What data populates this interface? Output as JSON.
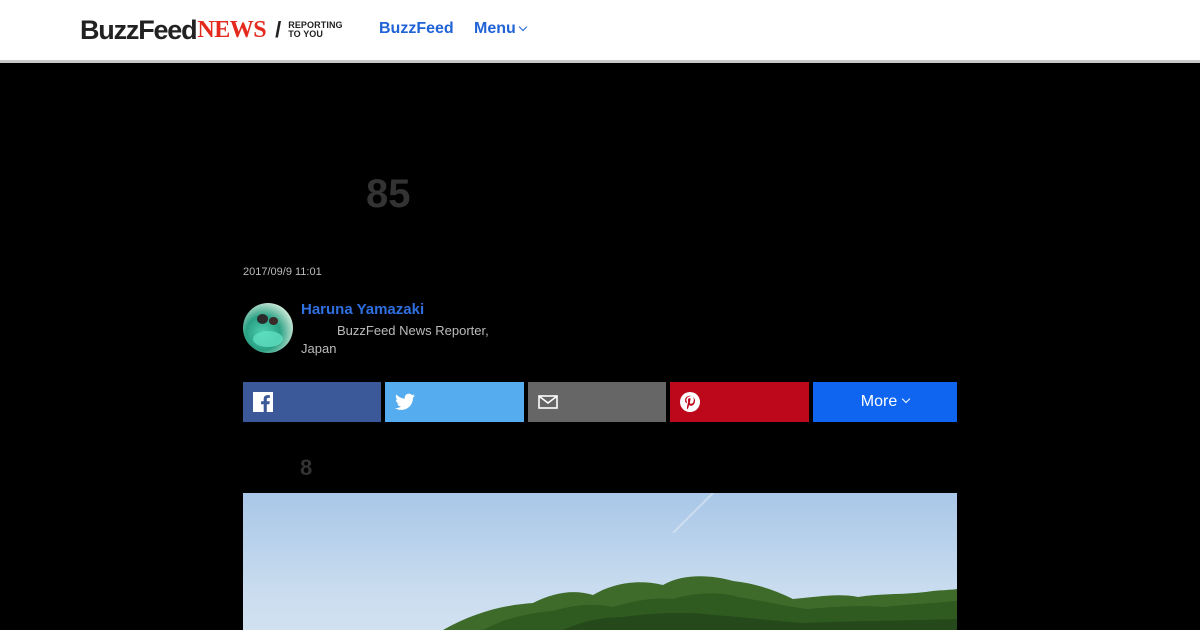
{
  "header": {
    "logo_part1": "BuzzFeed",
    "logo_part2": "NEWS",
    "tagline_line1": "REPORTING",
    "tagline_line2": "TO YOU",
    "nav_buzzfeed": "BuzzFeed",
    "nav_menu": "Menu"
  },
  "article": {
    "title": "85",
    "timestamp": "2017/09/9 11:01",
    "author_name": "Haruna Yamazaki",
    "author_role": "BuzzFeed News Reporter, Japan",
    "subheading": "8"
  },
  "share": {
    "facebook_icon": "facebook-icon",
    "twitter_icon": "twitter-icon",
    "email_icon": "email-icon",
    "pinterest_icon": "pinterest-icon",
    "more_label": "More"
  },
  "colors": {
    "accent_blue": "#1f63d6",
    "news_red": "#e32a1d",
    "facebook": "#3b5998",
    "twitter": "#55acee",
    "email": "#666666",
    "pinterest": "#bd081c",
    "more": "#0f65ef"
  }
}
